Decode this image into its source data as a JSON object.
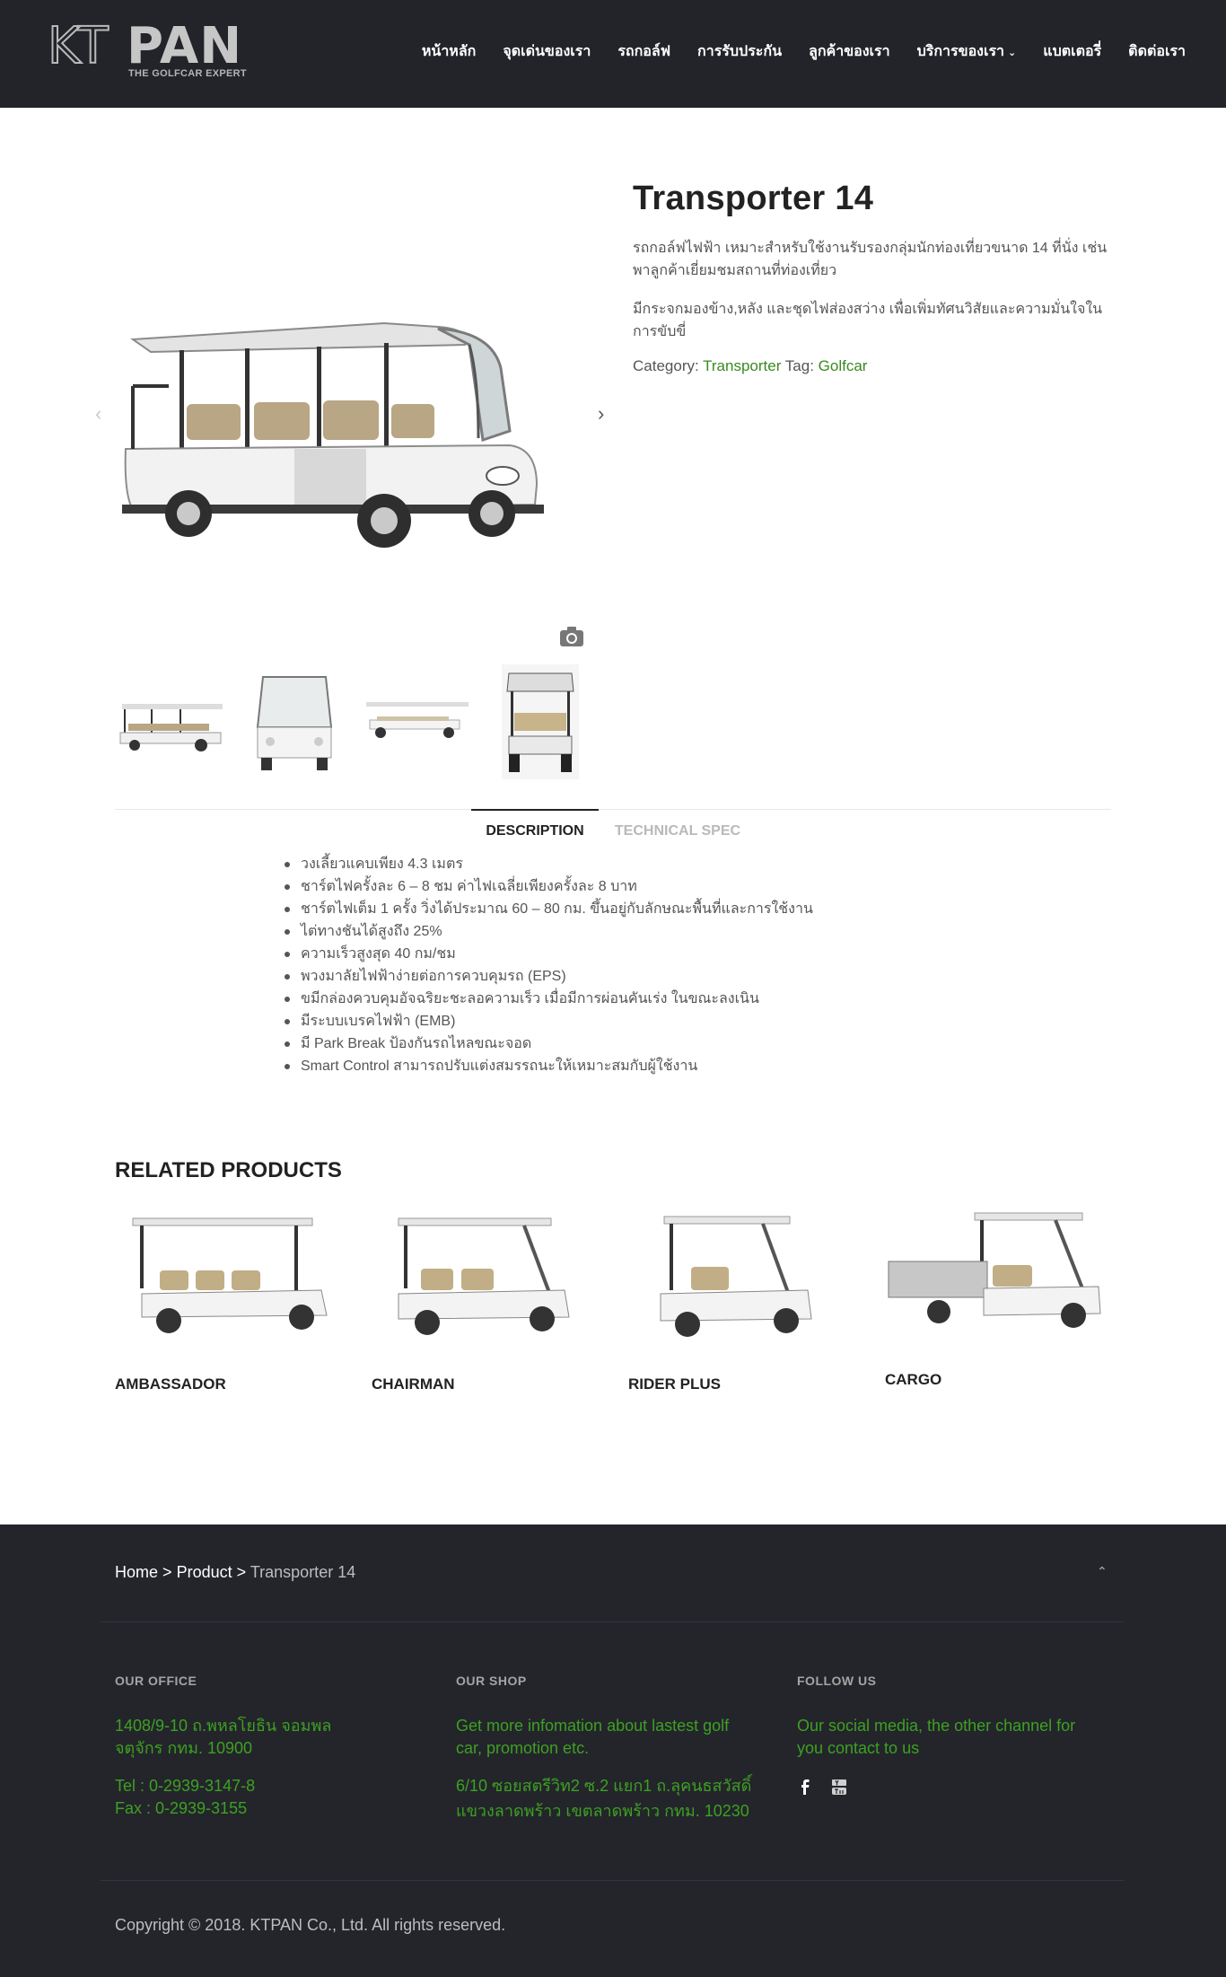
{
  "header": {
    "logo_outline": "KT",
    "logo_bold": "PAN",
    "logo_tagline": "THE GOLFCAR EXPERT",
    "nav": [
      {
        "label": "หน้าหลัก"
      },
      {
        "label": "จุดเด่นของเรา"
      },
      {
        "label": "รถกอล์ฟ"
      },
      {
        "label": "การรับประกัน"
      },
      {
        "label": "ลูกค้าของเรา"
      },
      {
        "label": "บริการของเรา"
      },
      {
        "label": "แบตเตอรี่"
      },
      {
        "label": "ติดต่อเรา"
      }
    ]
  },
  "product": {
    "title": "Transporter 14",
    "desc1": "รถกอล์ฟไฟฟ้า เหมาะสำหรับใช้งานรับรองกลุ่มนักท่องเที่ยวขนาด 14 ที่นั่ง เช่น พาลูกค้าเยี่ยมชมสถานที่ท่องเที่ยว",
    "desc2": "มีกระจกมองข้าง,หลัง และชุดไฟส่องสว่าง เพื่อเพิ่มทัศนวิสัยและความมั่นใจในการขับขี่",
    "category_label": "Category:",
    "category": "Transporter",
    "tag_label": "Tag:",
    "tag": "Golfcar"
  },
  "tabs": {
    "description": "DESCRIPTION",
    "technical": "TECHNICAL SPEC"
  },
  "features": [
    "วงเลี้ยวแคบเพียง 4.3 เมตร",
    "ชาร์ตไฟครั้งละ 6 – 8 ชม ค่าไฟเฉลี่ยเพียงครั้งละ 8 บาท",
    "ชาร์ตไฟเต็ม 1 ครั้ง วิ่งได้ประมาณ 60 – 80 กม. ขึ้นอยู่กับลักษณะพื้นที่และการใช้งาน",
    "ไต่ทางชันได้สูงถึง 25%",
    "ความเร็วสูงสุด 40 กม/ชม",
    "พวงมาลัยไฟฟ้าง่ายต่อการควบคุมรถ (EPS)",
    "ขมีกล่องควบคุมอัจฉริยะชะลอความเร็ว เมื่อมีการผ่อนคันเร่ง ในขณะลงเนิน",
    "มีระบบเบรคไฟฟ้า (EMB)",
    "มี Park Break ป้องกันรถไหลขณะจอด",
    "Smart Control สามารถปรับแต่งสมรรถนะให้เหมาะสมกับผู้ใช้งาน"
  ],
  "related": {
    "title": "RELATED PRODUCTS",
    "items": [
      {
        "name": "AMBASSADOR"
      },
      {
        "name": "CHAIRMAN"
      },
      {
        "name": "RIDER PLUS"
      },
      {
        "name": "CARGO"
      }
    ]
  },
  "footer": {
    "crumb_home": "Home",
    "crumb_sep": ">",
    "crumb_product": "Product",
    "crumb_current": "Transporter 14",
    "office_head": "OUR OFFICE",
    "office_addr1": "1408/9-10 ถ.พหลโยธิน จอมพล",
    "office_addr2": "จตุจักร กทม. 10900",
    "office_tel": "Tel : 0-2939-3147-8",
    "office_fax": "Fax : 0-2939-3155",
    "shop_head": "OUR SHOP",
    "shop_text1": "Get more infomation about lastest golf",
    "shop_text2": "car, promotion etc.",
    "shop_addr1": "6/10 ซอยสตรีวิท2 ซ.2 แยก1 ถ.ลุคนธสวัสดิ์",
    "shop_addr2": "แขวงลาดพร้าว เขตลาดพร้าว กทม. 10230",
    "follow_head": "FOLLOW US",
    "follow_text1": "Our social media, the other channel for",
    "follow_text2": "you contact to us",
    "copyright": "Copyright © 2018. KTPAN Co., Ltd. All rights reserved."
  },
  "colors": {
    "header_bg": "#22242a",
    "footer_bg": "#23252b",
    "link_green": "#3a8a1f",
    "footer_green": "#3ea022"
  }
}
